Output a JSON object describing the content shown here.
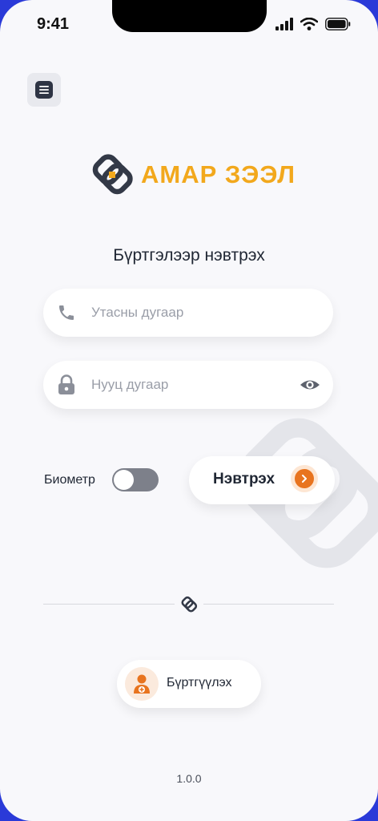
{
  "status": {
    "time": "9:41"
  },
  "brand": {
    "name": "АМАР ЗЭЭЛ"
  },
  "login": {
    "title": "Бүртгэлээр нэвтрэх",
    "phone_placeholder": "Утасны дугаар",
    "password_placeholder": "Нууц дугаар",
    "biometric_label": "Биометр",
    "biometric_enabled": false,
    "submit_label": "Нэвтрэх"
  },
  "register": {
    "label": "Бүртгүүлэх"
  },
  "footer": {
    "version": "1.0.0"
  },
  "colors": {
    "accent": "#e8741f",
    "brand_gold": "#f2a81c",
    "dark": "#2e3444"
  },
  "icons": [
    "menu-icon",
    "phone-icon",
    "lock-icon",
    "eye-icon",
    "chevron-right-icon",
    "user-add-icon",
    "brand-logo-icon"
  ]
}
